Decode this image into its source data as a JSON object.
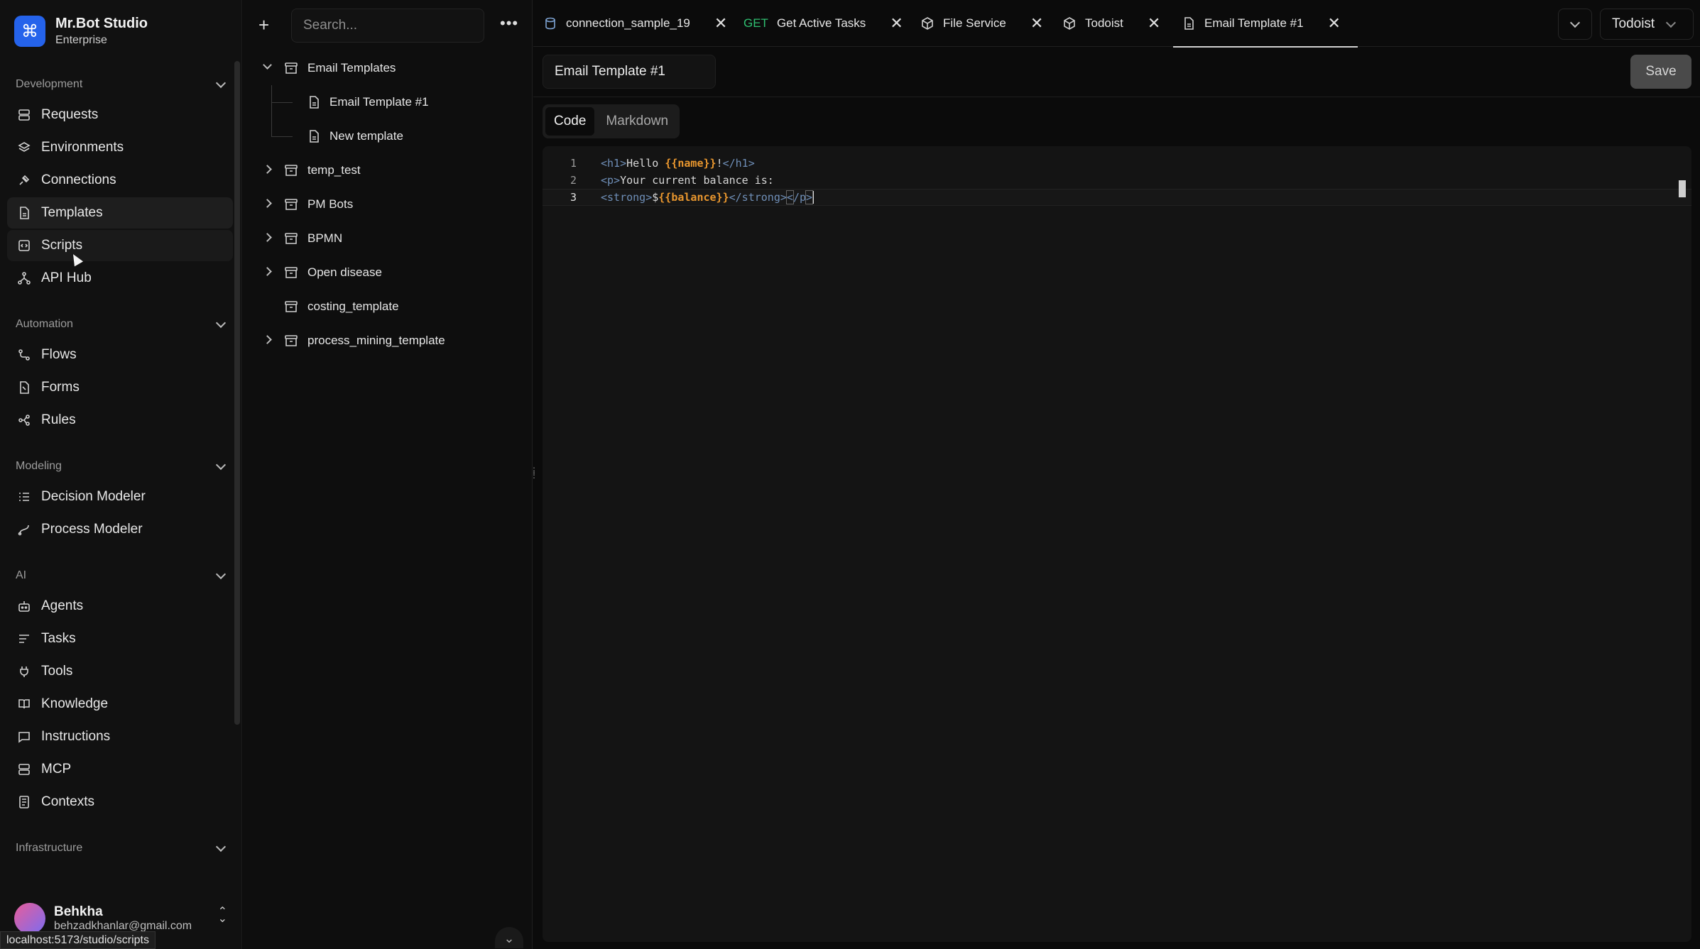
{
  "brand": {
    "name": "Mr.Bot Studio",
    "edition": "Enterprise",
    "logo_glyph": "⌘",
    "accent": "#2563eb"
  },
  "sidebar": {
    "sections": [
      {
        "title": "Development",
        "items": [
          "Requests",
          "Environments",
          "Connections",
          "Templates",
          "Scripts",
          "API Hub"
        ]
      },
      {
        "title": "Automation",
        "items": [
          "Flows",
          "Forms",
          "Rules"
        ]
      },
      {
        "title": "Modeling",
        "items": [
          "Decision Modeler",
          "Process Modeler"
        ]
      },
      {
        "title": "AI",
        "items": [
          "Agents",
          "Tasks",
          "Tools",
          "Knowledge",
          "Instructions",
          "MCP",
          "Contexts"
        ]
      },
      {
        "title": "Infrastructure",
        "items": []
      }
    ],
    "active_item": "Templates",
    "hovered_item": "Scripts"
  },
  "user": {
    "name": "Behkha",
    "email": "behzadkhanlar@gmail.com"
  },
  "status_bar_url": "localhost:5173/studio/scripts",
  "tree": {
    "search_placeholder": "Search...",
    "items": [
      {
        "label": "Email Templates",
        "expanded": true
      },
      {
        "label": "Email Template #1",
        "child": true
      },
      {
        "label": "New template",
        "child": true
      },
      {
        "label": "temp_test"
      },
      {
        "label": "PM Bots"
      },
      {
        "label": "BPMN"
      },
      {
        "label": "Open disease"
      },
      {
        "label": "costing_template"
      },
      {
        "label": "process_mining_template"
      }
    ]
  },
  "tabs": [
    {
      "label": "connection_sample_19",
      "icon": "database-icon"
    },
    {
      "label": "Get Active Tasks",
      "method": "GET"
    },
    {
      "label": "File Service",
      "icon": "cube-icon"
    },
    {
      "label": "Todoist",
      "icon": "cube-icon"
    },
    {
      "label": "Email Template #1",
      "icon": "file-icon",
      "active": true
    }
  ],
  "workspace": "Todoist",
  "editor": {
    "title": "Email Template #1",
    "save_label": "Save",
    "modes": [
      "Code",
      "Markdown"
    ],
    "active_mode": "Code",
    "line_numbers": [
      "1",
      "2",
      "3"
    ]
  }
}
